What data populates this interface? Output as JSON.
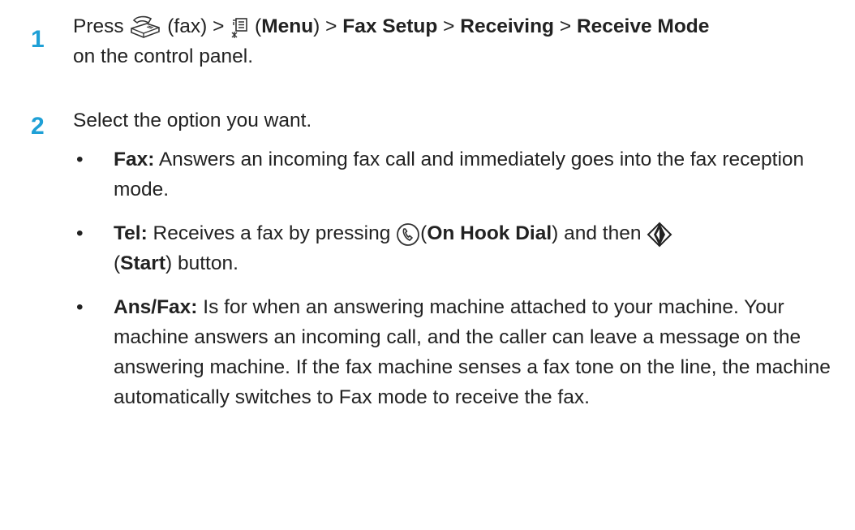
{
  "steps": [
    {
      "number": "1",
      "parts": {
        "press": "Press",
        "fax_paren": "(fax) >",
        "menu_open": "(",
        "menu_label": "Menu",
        "menu_close": ") >",
        "fax_setup": "Fax Setup",
        "sep1": ">",
        "receiving": "Receiving",
        "sep2": ">",
        "receive_mode": "Receive Mode",
        "tail": "on the control panel."
      },
      "icons": [
        "fax-icon",
        "menu-icon"
      ]
    },
    {
      "number": "2",
      "text": "Select the option you want."
    }
  ],
  "options": [
    {
      "bullet": "•",
      "term": "Fax:",
      "desc": " Answers an incoming fax call and immediately goes into the fax reception mode."
    },
    {
      "bullet": "•",
      "term": "Tel:",
      "desc_a": " Receives a fax by pressing ",
      "on_hook_open": "(",
      "on_hook_label": "On Hook Dial",
      "on_hook_close": ") and then ",
      "start_open": "(",
      "start_label": "Start",
      "start_close": ") button.",
      "icons": [
        "on-hook-dial-icon",
        "start-icon"
      ]
    },
    {
      "bullet": "•",
      "term": "Ans/Fax:",
      "desc": " Is for when an answering machine attached to your machine. Your machine answers an incoming call, and the caller can leave a message on the answering machine. If the fax machine senses a fax tone on the line, the machine automatically switches to Fax mode to receive the fax."
    }
  ],
  "colors": {
    "step_number": "#1fa0d6",
    "text": "#222222"
  }
}
